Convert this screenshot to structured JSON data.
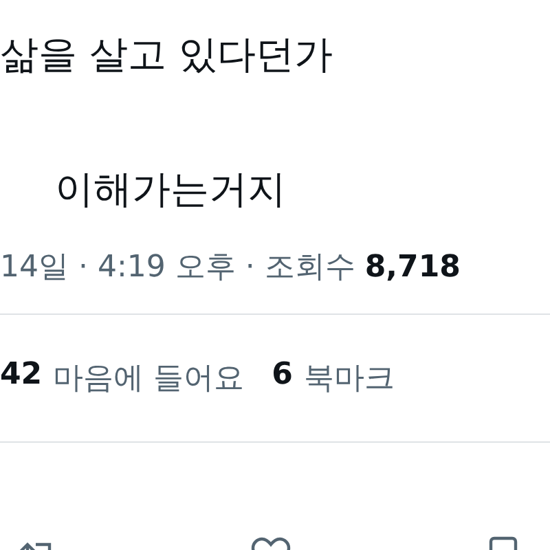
{
  "tweet_text": [
    "삶을 살고 있다던가",
    "이해가는거지"
  ],
  "meta": {
    "date_time": "14일 · 4:19 오후 · 조회수",
    "views": "8,718"
  },
  "stats": [
    {
      "count": "42",
      "label": "마음에 들어요"
    },
    {
      "count": "6",
      "label": "북마크"
    }
  ]
}
